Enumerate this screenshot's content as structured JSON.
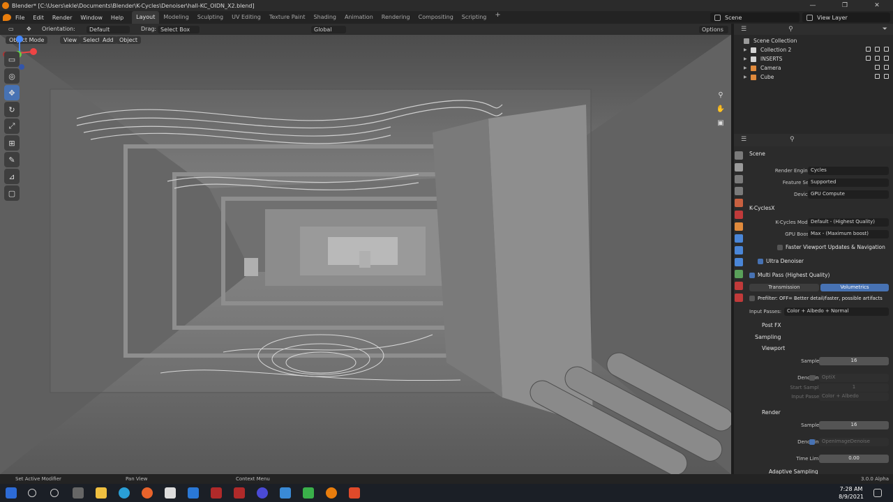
{
  "window": {
    "title": "Blender* [C:\\Users\\ekle\\Documents\\Blender\\K-Cycles\\Denoiser\\hall-KC_OIDN_X2.blend]",
    "controls": [
      "—",
      "❐",
      "✕"
    ]
  },
  "menu": [
    "File",
    "Edit",
    "Render",
    "Window",
    "Help"
  ],
  "workspaces": {
    "active": "Layout",
    "tabs": [
      "Layout",
      "Modeling",
      "Sculpting",
      "UV Editing",
      "Texture Paint",
      "Shading",
      "Animation",
      "Rendering",
      "Compositing",
      "Scripting"
    ],
    "add": "+"
  },
  "scene_selector": "Scene",
  "view_layer_selector": "View Layer",
  "tool_header": {
    "orientation_label": "Orientation:",
    "orientation_value": "Default",
    "drag_label": "Drag:",
    "drag_value": "Select Box",
    "transform_orientation": "Global",
    "options": "Options"
  },
  "viewport_header": {
    "mode": "Object Mode",
    "view": "View",
    "select": "Select",
    "add": "Add",
    "object": "Object"
  },
  "toolbar_tools": [
    "select",
    "cursor",
    "move",
    "rotate",
    "scale",
    "transform",
    "annotate",
    "measure",
    "add-cube"
  ],
  "outliner": {
    "root": "Scene Collection",
    "items": [
      {
        "label": "Collection 2",
        "icon_color": "#d4d4d4"
      },
      {
        "label": "INSERTS",
        "icon_color": "#d4d4d4"
      },
      {
        "label": "Camera",
        "icon_color": "#e08a3c"
      },
      {
        "label": "Cube",
        "icon_color": "#e08a3c"
      }
    ]
  },
  "properties": {
    "context": "Scene",
    "render_engine_label": "Render Engine",
    "render_engine": "Cycles",
    "feature_set_label": "Feature Set",
    "feature_set": "Supported",
    "device_label": "Device",
    "device": "GPU Compute",
    "kcycles_section": "K-CyclesX",
    "kcycles_mode_label": "K-Cycles Mode",
    "kcycles_mode": "Default - (Highest Quality)",
    "gpu_boost_label": "GPU Boost",
    "gpu_boost": "Max - (Maximum boost)",
    "faster_viewport": "Faster Viewport Updates & Navigation",
    "ultra_denoiser": "Ultra Denoiser",
    "multi_pass": "Multi Pass (Highest Quality)",
    "transmission": "Transmission",
    "volumetrics": "Volumetrics",
    "prefilter": "Prefilter: OFF= Better detail/faster, possible artifacts",
    "input_passes_label": "Input Passes:",
    "input_passes": "Color + Albedo + Normal",
    "post_fx": "Post FX",
    "sampling": "Sampling",
    "viewport_section": "Viewport",
    "samples_label": "Samples",
    "viewport_samples": "16",
    "denoising_label": "Denoising",
    "viewport_denoiser": "OptiX",
    "start_sample_label": "Start Sample",
    "start_sample": "1",
    "input_passes2_label": "Input Passes",
    "viewport_input_passes": "Color + Albedo",
    "render_section": "Render",
    "render_samples": "16",
    "render_denoiser": "OpenImageDenoise",
    "time_limit_label": "Time Limit",
    "time_limit": "0.00",
    "adaptive_sampling": "Adaptive Sampling"
  },
  "status": {
    "left": "Set Active Modifier",
    "middle": "Pan View",
    "right": "Context Menu",
    "version": "3.0.0 Alpha"
  },
  "taskbar": {
    "time": "7:28 AM",
    "date": "8/9/2021"
  },
  "colors": {
    "accent": "#4772b3",
    "blender_orange": "#e87d0d"
  }
}
